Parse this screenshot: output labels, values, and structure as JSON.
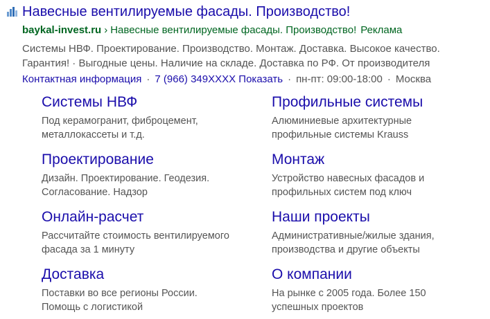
{
  "ad": {
    "favicon": "bar-chart-favicon-icon",
    "title": "Навесные вентилируемые фасады. Производство!",
    "domain": "baykal-invest.ru",
    "separator": "›",
    "breadcrumb": "Навесные вентилируемые фасады. Производство!",
    "ad_label": "Реклама",
    "description_line1": "Системы НВФ. Проектирование. Производство. Монтаж. Доставка. Высокое качество.",
    "description_line2": "Гарантия! · Выгодные цены. Наличие на складе. Доставка по РФ. От производителя",
    "contact_info": "Контактная информация",
    "phone": "7 (966) 349XXXX",
    "show_phone": "Показать",
    "hours": "пн-пт: 09:00-18:00",
    "city": "Москва",
    "dot": "·"
  },
  "sitelinks": [
    {
      "title": "Системы НВФ",
      "desc1": "Под керамогранит, фиброцемент,",
      "desc2": "металлокассеты и т.д."
    },
    {
      "title": "Профильные системы",
      "desc1": "Алюминиевые архитектурные",
      "desc2": "профильные системы Krauss"
    },
    {
      "title": "Проектирование",
      "desc1": "Дизайн. Проектирование. Геодезия.",
      "desc2": "Согласование. Надзор"
    },
    {
      "title": "Монтаж",
      "desc1": "Устройство навесных фасадов и",
      "desc2": "профильных систем под ключ"
    },
    {
      "title": "Онлайн-расчет",
      "desc1": "Рассчитайте стоимость вентилируемого",
      "desc2": "фасада за 1 минуту"
    },
    {
      "title": "Наши проекты",
      "desc1": "Административные/жилые здания,",
      "desc2": "производства и другие объекты"
    },
    {
      "title": "Доставка",
      "desc1": "Поставки во все регионы России.",
      "desc2": "Помощь с логистикой"
    },
    {
      "title": "О компании",
      "desc1": "На рынке с 2005 года. Более 150",
      "desc2": "успешных проектов"
    }
  ],
  "colors": {
    "link": "#1a0dab",
    "url_green": "#006621",
    "text_gray": "#545454",
    "favicon_blue": "#4a86c8"
  }
}
